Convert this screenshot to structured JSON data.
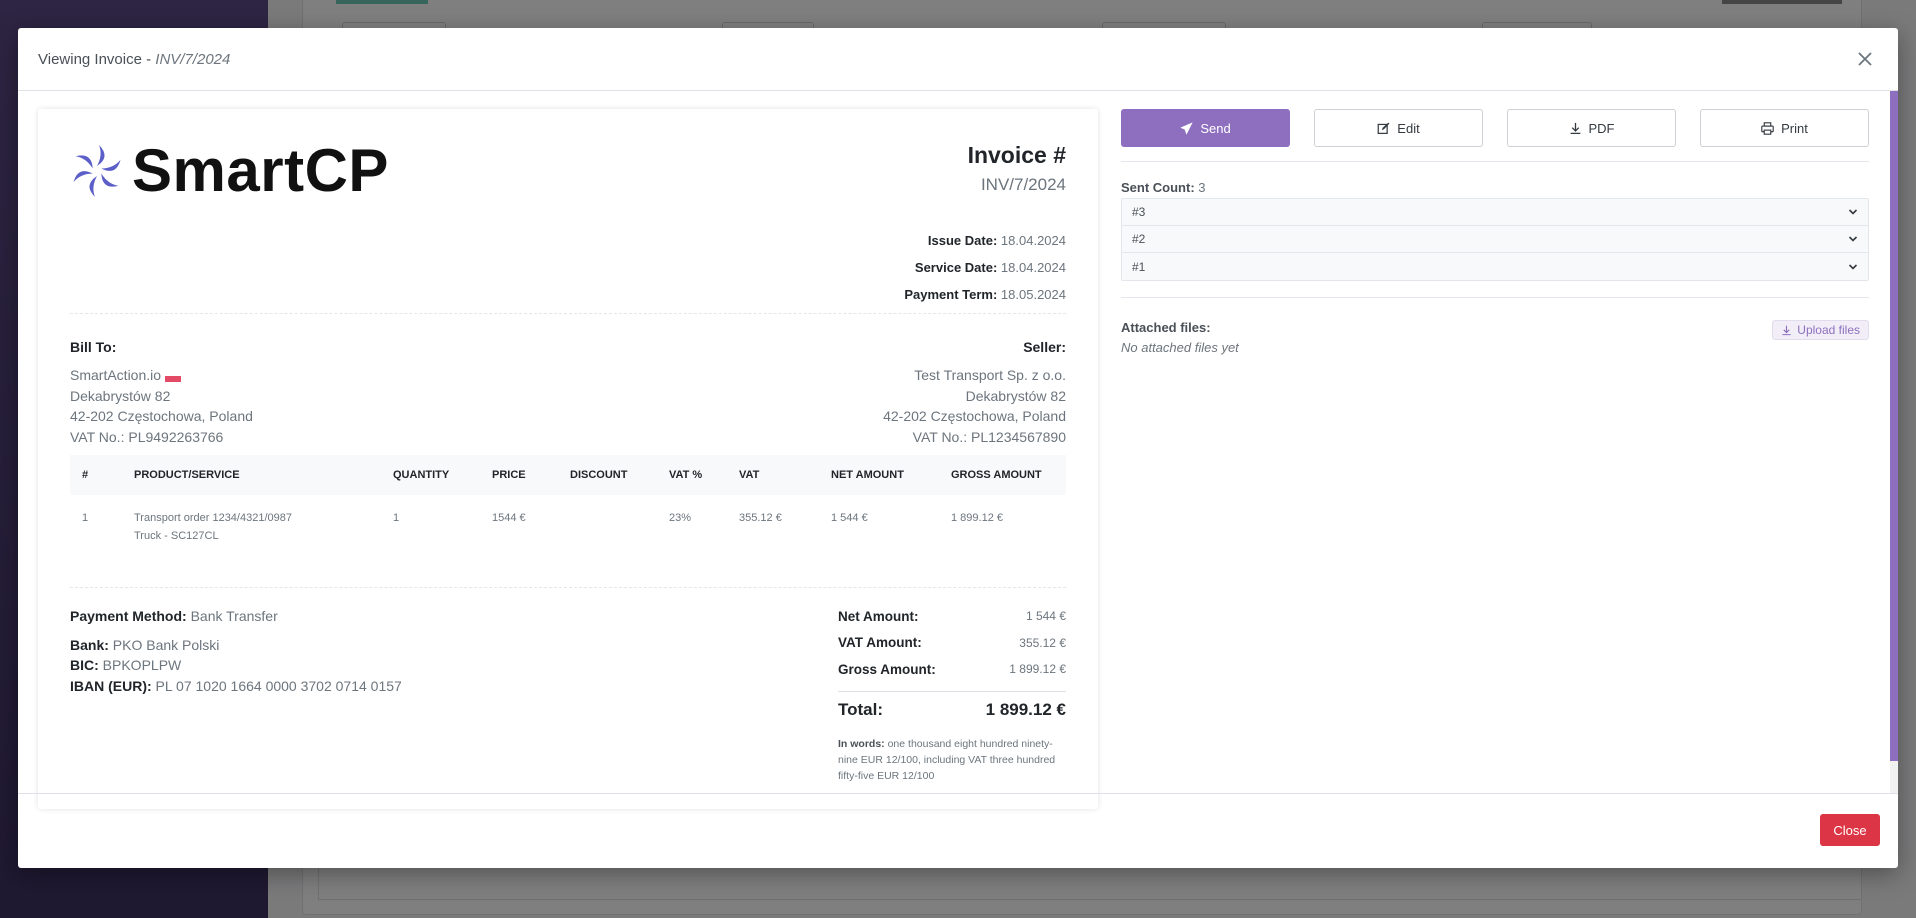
{
  "modal": {
    "title_prefix": "Viewing Invoice - ",
    "title_number": "INV/7/2024",
    "close_label": "Close"
  },
  "invoice": {
    "logo_text": "SmartCP",
    "title": "Invoice #",
    "number": "INV/7/2024",
    "dates": [
      {
        "label": "Issue Date:",
        "value": "18.04.2024"
      },
      {
        "label": "Service Date:",
        "value": "18.04.2024"
      },
      {
        "label": "Payment Term:",
        "value": "18.05.2024"
      }
    ],
    "bill_to": {
      "title": "Bill To:",
      "name": "SmartAction.io",
      "street": "Dekabrystów 82",
      "city": "42-202 Częstochowa, Poland",
      "vat": "VAT No.: PL9492263766"
    },
    "seller": {
      "title": "Seller:",
      "name": "Test Transport Sp. z o.o.",
      "street": "Dekabrystów 82",
      "city": "42-202 Częstochowa, Poland",
      "vat": "VAT No.: PL1234567890"
    },
    "columns": [
      "#",
      "PRODUCT/SERVICE",
      "QUANTITY",
      "PRICE",
      "DISCOUNT",
      "VAT %",
      "VAT",
      "NET AMOUNT",
      "GROSS AMOUNT"
    ],
    "rows": [
      {
        "no": "1",
        "product_line1": "Transport order 1234/4321/0987",
        "product_line2": "Truck - SC127CL",
        "quantity": "1",
        "price": "1544 €",
        "discount": "",
        "vat_pct": "23%",
        "vat": "355.12 €",
        "net": "1 544 €",
        "gross": "1 899.12 €"
      }
    ],
    "payment": {
      "method_label": "Payment Method:",
      "method_value": "Bank Transfer",
      "bank_label": "Bank:",
      "bank_value": "PKO Bank Polski",
      "bic_label": "BIC:",
      "bic_value": "BPKOPLPW",
      "iban_label": "IBAN (EUR):",
      "iban_value": "PL 07 1020 1664 0000 3702 0714 0157"
    },
    "totals": {
      "net_label": "Net Amount:",
      "net_value": "1 544 €",
      "vat_label": "VAT Amount:",
      "vat_value": "355.12 €",
      "gross_label": "Gross Amount:",
      "gross_value": "1 899.12 €",
      "total_label": "Total:",
      "total_value": "1 899.12 €",
      "in_words_label": "In words:",
      "in_words_value": " one thousand eight hundred ninety-nine EUR 12/100, including VAT three hundred fifty-five EUR 12/100"
    }
  },
  "actions": {
    "send": "Send",
    "edit": "Edit",
    "pdf": "PDF",
    "print": "Print"
  },
  "sent": {
    "label": "Sent Count:",
    "count": "3",
    "items": [
      "#3",
      "#2",
      "#1"
    ]
  },
  "attachments": {
    "title": "Attached files:",
    "empty": "No attached files yet",
    "upload": "Upload files"
  },
  "colors": {
    "accent": "#8e6fbf",
    "danger": "#dc3545",
    "flag": "#e24a66"
  }
}
